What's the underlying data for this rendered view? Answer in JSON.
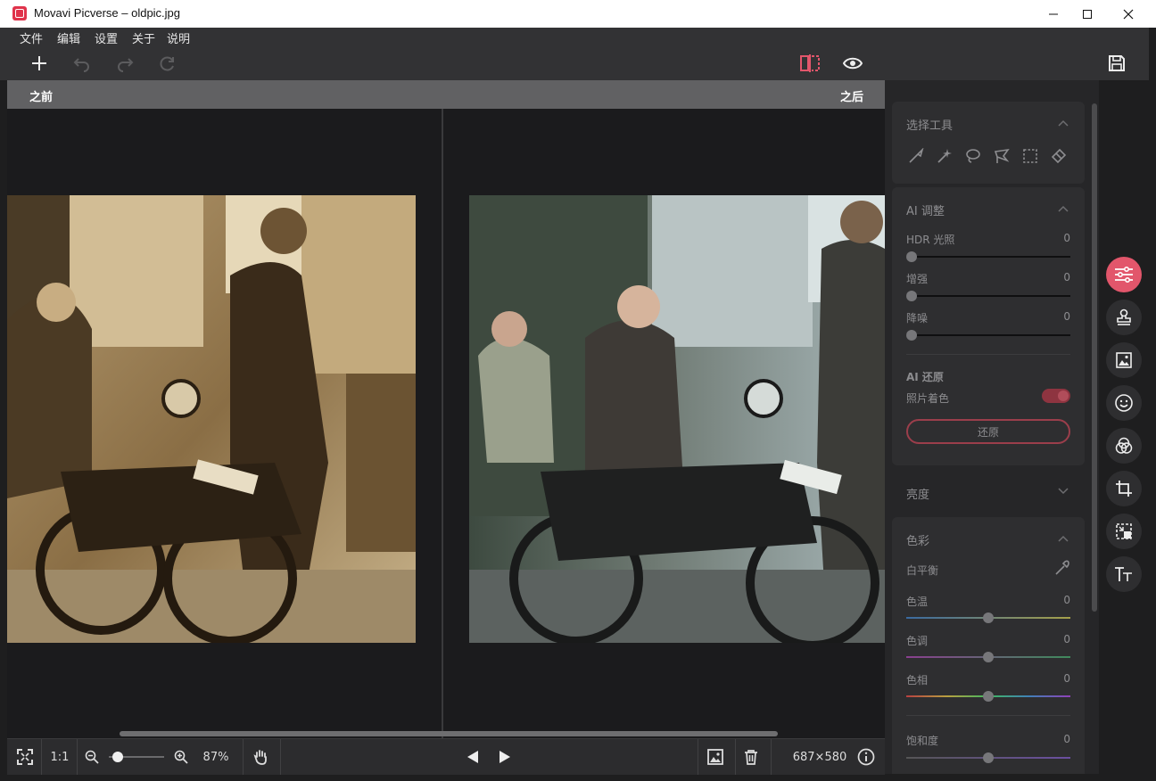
{
  "window": {
    "title": "Movavi Picverse – oldpic.jpg"
  },
  "menu": [
    "文件",
    "编辑",
    "设置",
    "关于",
    "说明"
  ],
  "compare": {
    "before_label": "之前",
    "after_label": "之后"
  },
  "bottom": {
    "one_to_one": "1:1",
    "zoom": "87%",
    "dimensions": "687×580"
  },
  "panel": {
    "selection_tools": {
      "title": "选择工具"
    },
    "ai_adjust": {
      "title": "AI 调整",
      "sliders": [
        {
          "label": "HDR 光照",
          "value": "0"
        },
        {
          "label": "增强",
          "value": "0"
        },
        {
          "label": "降噪",
          "value": "0"
        }
      ]
    },
    "ai_restore": {
      "title": "AI 还原",
      "colorize_label": "照片着色",
      "restore_button": "还原",
      "colorize_on": true
    },
    "brightness": {
      "title": "亮度"
    },
    "color": {
      "title": "色彩",
      "white_balance": "白平衡",
      "sliders": [
        {
          "label": "色温",
          "value": "0"
        },
        {
          "label": "色调",
          "value": "0"
        },
        {
          "label": "色相",
          "value": "0"
        },
        {
          "label": "饱和度",
          "value": "0"
        }
      ]
    }
  },
  "colors": {
    "accent": "#e2566b",
    "panel": "#2e2e30",
    "toolbar": "#323234"
  }
}
